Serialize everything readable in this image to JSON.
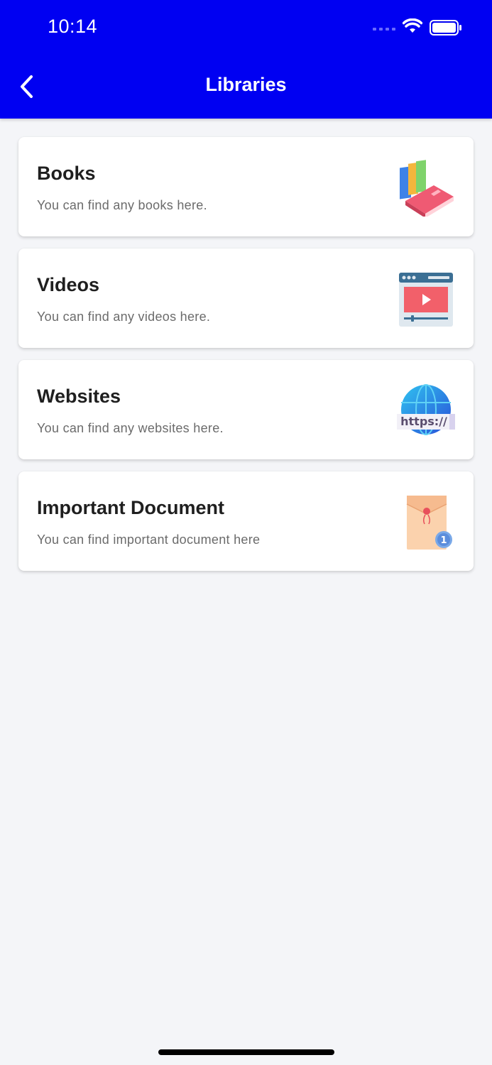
{
  "status_bar": {
    "time": "10:14",
    "icons": [
      "cellular-signal-icon",
      "wifi-icon",
      "battery-icon"
    ]
  },
  "app_bar": {
    "title": "Libraries",
    "back_icon": "chevron-left-icon",
    "background_color": "#0000f2"
  },
  "libraries": [
    {
      "title": "Books",
      "description": "You can find any books here.",
      "icon": "books-icon"
    },
    {
      "title": "Videos",
      "description": "You can find any videos here.",
      "icon": "video-player-icon"
    },
    {
      "title": "Websites",
      "description": "You can find any websites here.",
      "icon": "globe-https-icon"
    },
    {
      "title": "Important Document",
      "description": "You can find important document here",
      "icon": "document-envelope-icon"
    }
  ]
}
